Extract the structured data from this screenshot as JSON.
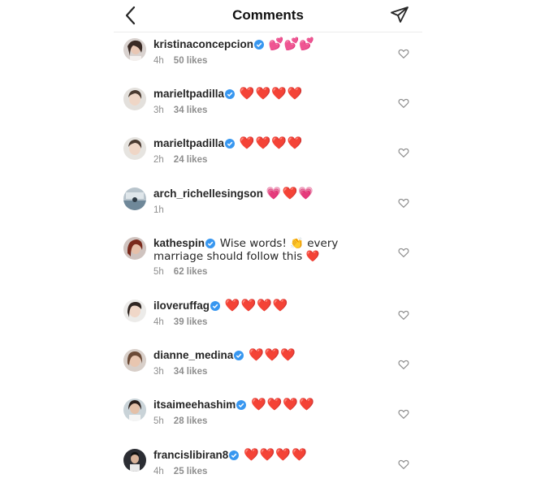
{
  "header": {
    "title": "Comments",
    "back_icon": "chevron-left-icon",
    "send_icon": "paper-plane-icon"
  },
  "colors": {
    "verified": "#3897f0",
    "heart_red": "#ed1c24",
    "heart_pink": "#e8409a",
    "meta_gray": "#8e8e8e"
  },
  "comments": [
    {
      "username": "kristinaconcepcion",
      "verified": true,
      "text": "💕💕💕",
      "time": "4h",
      "likes": "50 likes"
    },
    {
      "username": "marieltpadilla",
      "verified": true,
      "text": "❤️❤️❤️❤️",
      "time": "3h",
      "likes": "34 likes"
    },
    {
      "username": "marieltpadilla",
      "verified": true,
      "text": "❤️❤️❤️❤️",
      "time": "2h",
      "likes": "24 likes"
    },
    {
      "username": "arch_richellesingson",
      "verified": false,
      "text": "💗❤️💗",
      "time": "1h",
      "likes": ""
    },
    {
      "username": "kathespin",
      "verified": true,
      "text": "Wise words! 👏 every marriage should follow this ❤️",
      "time": "5h",
      "likes": "62 likes"
    },
    {
      "username": "iloveruffag",
      "verified": true,
      "text": "❤️❤️❤️❤️",
      "time": "4h",
      "likes": "39 likes"
    },
    {
      "username": "dianne_medina",
      "verified": true,
      "text": "❤️❤️❤️",
      "time": "3h",
      "likes": "34 likes"
    },
    {
      "username": "itsaimeehashim",
      "verified": true,
      "text": "❤️❤️❤️❤️",
      "time": "5h",
      "likes": "28 likes"
    },
    {
      "username": "francislibiran8",
      "verified": true,
      "text": "❤️❤️❤️❤️",
      "time": "4h",
      "likes": "25 likes"
    }
  ]
}
